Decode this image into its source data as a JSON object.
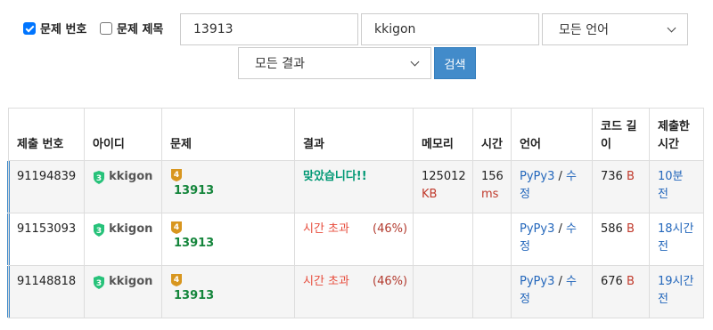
{
  "filters": {
    "problem_number_label": "문제 번호",
    "problem_number_checked": true,
    "problem_title_label": "문제 제목",
    "problem_title_checked": false,
    "problem_id_value": "13913",
    "user_id_value": "kkigon",
    "language_selected": "모든 언어",
    "result_selected": "모든 결과",
    "search_label": "검색"
  },
  "table": {
    "headers": {
      "submission_id": "제출 번호",
      "user_id": "아이디",
      "problem": "문제",
      "result": "결과",
      "memory": "메모리",
      "time": "시간",
      "language": "언어",
      "code_length": "코드 길이",
      "submitted_at": "제출한 시간"
    },
    "rows": [
      {
        "submission_id": "91194839",
        "user_tier": "3",
        "user": "kkigon",
        "problem_tier": "4",
        "problem_id": "13913",
        "result": "맞았습니다!!",
        "result_percent": "",
        "memory": "125012",
        "memory_unit": "KB",
        "time": "156",
        "time_unit": "ms",
        "language": "PyPy3",
        "edit_label": "수정",
        "code_length": "736",
        "code_unit": "B",
        "submitted": "10분 전"
      },
      {
        "submission_id": "91153093",
        "user_tier": "3",
        "user": "kkigon",
        "problem_tier": "4",
        "problem_id": "13913",
        "result": "시간 초과",
        "result_percent": "(46%)",
        "memory": "",
        "memory_unit": "",
        "time": "",
        "time_unit": "",
        "language": "PyPy3",
        "edit_label": "수정",
        "code_length": "586",
        "code_unit": "B",
        "submitted": "18시간 전"
      },
      {
        "submission_id": "91148818",
        "user_tier": "3",
        "user": "kkigon",
        "problem_tier": "4",
        "problem_id": "13913",
        "result": "시간 초과",
        "result_percent": "(46%)",
        "memory": "",
        "memory_unit": "",
        "time": "",
        "time_unit": "",
        "language": "PyPy3",
        "edit_label": "수정",
        "code_length": "676",
        "code_unit": "B",
        "submitted": "19시간 전"
      }
    ]
  },
  "colors": {
    "accent": "#428bca",
    "accepted": "#009874",
    "time_limit": "#e74c3c",
    "user_tier_badge": "#27c27a",
    "problem_tier_badge": "#d8961f"
  }
}
